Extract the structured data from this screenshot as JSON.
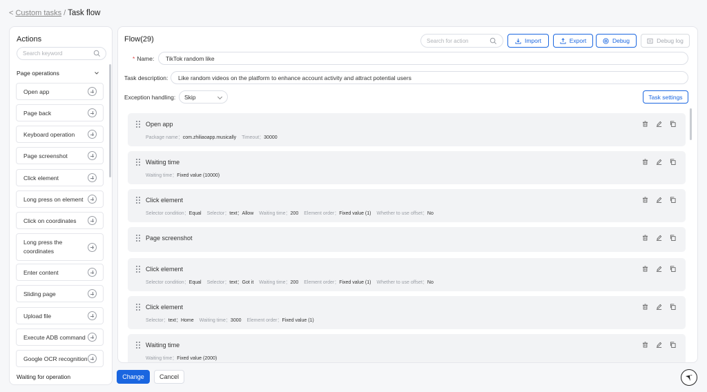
{
  "breadcrumb": {
    "back": "<",
    "parent": "Custom tasks",
    "sep": "/",
    "current": "Task flow"
  },
  "actions": {
    "title": "Actions",
    "search_placeholder": "Search keyword",
    "group": "Page operations",
    "items": [
      "Open app",
      "Page back",
      "Keyboard operation",
      "Page screenshot",
      "Click element",
      "Long press on element",
      "Click on coordinates",
      "Long press the coordinates",
      "Enter content",
      "Sliding page",
      "Upload file",
      "Execute ADB command",
      "Google OCR recognition"
    ],
    "next_group": "Waiting for operation"
  },
  "flow": {
    "title": "Flow(29)",
    "search_placeholder": "Search for action",
    "import_label": "Import",
    "export_label": "Export",
    "debug_label": "Debug",
    "debug_log_label": "Debug log",
    "name_label": "Name",
    "name_value": "TikTok random like",
    "desc_label": "Task description",
    "desc_value": "Like random videos on the platform to enhance account activity and attract potential users",
    "exception_label": "Exception handling",
    "exception_value": "Skip",
    "task_settings_label": "Task settings",
    "steps": [
      {
        "title": "Open app",
        "params": [
          [
            "Package name",
            "com.zhiliaoapp.musically"
          ],
          [
            "Timeout",
            "30000"
          ]
        ]
      },
      {
        "title": "Waiting time",
        "params": [
          [
            "Waiting time",
            "Fixed value (10000)"
          ]
        ]
      },
      {
        "title": "Click element",
        "params": [
          [
            "Selector condition",
            "Equal"
          ],
          [
            "Selector",
            "text：Allow"
          ],
          [
            "Waiting time",
            "200"
          ],
          [
            "Element order",
            "Fixed value (1)"
          ],
          [
            "Whether to use offset",
            "No"
          ]
        ]
      },
      {
        "title": "Page screenshot",
        "params": []
      },
      {
        "title": "Click element",
        "params": [
          [
            "Selector condition",
            "Equal"
          ],
          [
            "Selector",
            "text：Got it"
          ],
          [
            "Waiting time",
            "200"
          ],
          [
            "Element order",
            "Fixed value (1)"
          ],
          [
            "Whether to use offset",
            "No"
          ]
        ]
      },
      {
        "title": "Click element",
        "params": [
          [
            "Selector",
            "text：Home"
          ],
          [
            "Waiting time",
            "3000"
          ],
          [
            "Element order",
            "Fixed value (1)"
          ]
        ]
      },
      {
        "title": "Waiting time",
        "params": [
          [
            "Waiting time",
            "Fixed value (2000)"
          ]
        ]
      }
    ]
  },
  "footer": {
    "change_label": "Change",
    "cancel_label": "Cancel"
  },
  "colors": {
    "primary": "#1a66e0",
    "card_bg": "#f2f3f5",
    "border": "#e5e6eb"
  }
}
